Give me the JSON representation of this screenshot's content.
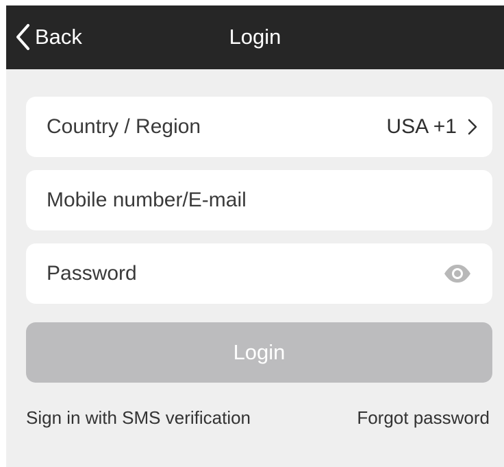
{
  "header": {
    "back_label": "Back",
    "title": "Login"
  },
  "form": {
    "country": {
      "label": "Country / Region",
      "value": "USA +1"
    },
    "account": {
      "placeholder": "Mobile number/E-mail",
      "value": ""
    },
    "password": {
      "placeholder": "Password",
      "value": ""
    },
    "login_label": "Login"
  },
  "links": {
    "sms_signin": "Sign in with SMS verification",
    "forgot_password": "Forgot password"
  },
  "icons": {
    "back": "chevron-left-icon",
    "country_chevron": "chevron-right-icon",
    "password_toggle": "eye-icon"
  },
  "colors": {
    "header_bg": "#262626",
    "page_bg": "#efefef",
    "card_bg": "#ffffff",
    "login_button_disabled": "#bcbcbe",
    "eye_icon": "#b8b8b8"
  }
}
